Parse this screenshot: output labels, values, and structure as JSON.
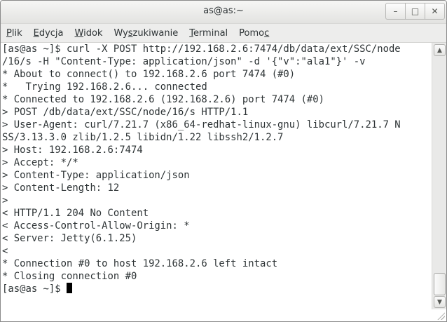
{
  "window": {
    "title": "as@as:~",
    "controls": {
      "minimize_icon": "–",
      "maximize_icon": "□",
      "close_icon": "✕"
    }
  },
  "menu": {
    "items": [
      {
        "pre": "",
        "mnemonic": "P",
        "post": "lik"
      },
      {
        "pre": "",
        "mnemonic": "E",
        "post": "dycja"
      },
      {
        "pre": "",
        "mnemonic": "W",
        "post": "idok"
      },
      {
        "pre": "Wy",
        "mnemonic": "s",
        "post": "zukiwanie"
      },
      {
        "pre": "",
        "mnemonic": "T",
        "post": "erminal"
      },
      {
        "pre": "Pomo",
        "mnemonic": "c",
        "post": ""
      }
    ]
  },
  "terminal": {
    "lines": [
      "[as@as ~]$ curl -X POST http://192.168.2.6:7474/db/data/ext/SSC/node",
      "/16/s -H \"Content-Type: application/json\" -d '{\"v\":\"ala1\"}' -v",
      "* About to connect() to 192.168.2.6 port 7474 (#0)",
      "*   Trying 192.168.2.6... connected",
      "* Connected to 192.168.2.6 (192.168.2.6) port 7474 (#0)",
      "> POST /db/data/ext/SSC/node/16/s HTTP/1.1",
      "> User-Agent: curl/7.21.7 (x86_64-redhat-linux-gnu) libcurl/7.21.7 N",
      "SS/3.13.3.0 zlib/1.2.5 libidn/1.22 libssh2/1.2.7",
      "> Host: 192.168.2.6:7474",
      "> Accept: */*",
      "> Content-Type: application/json",
      "> Content-Length: 12",
      ">",
      "< HTTP/1.1 204 No Content",
      "< Access-Control-Allow-Origin: *",
      "< Server: Jetty(6.1.25)",
      "<",
      "* Connection #0 to host 192.168.2.6 left intact",
      "* Closing connection #0"
    ],
    "prompt": "[as@as ~]$ "
  },
  "scrollbar": {
    "up_icon": "▲",
    "down_icon": "▼"
  }
}
